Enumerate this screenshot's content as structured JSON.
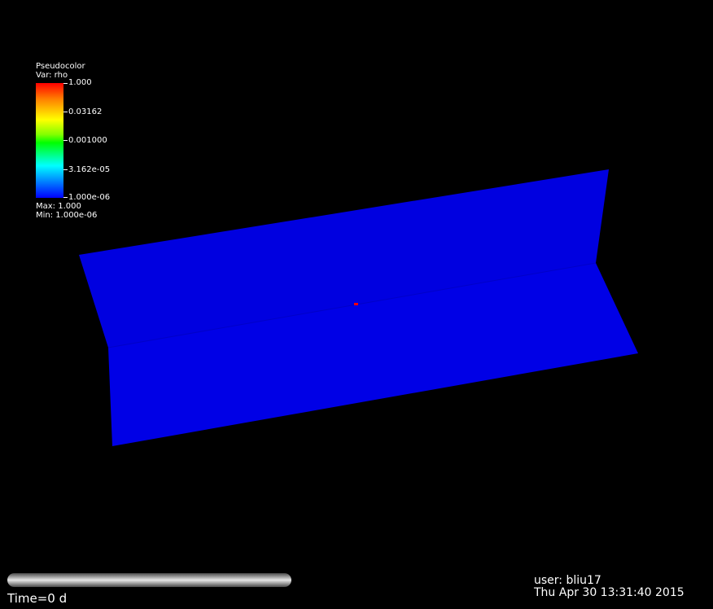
{
  "legend": {
    "title": "Pseudocolor",
    "var_label": "Var: rho",
    "ticks": [
      "1.000",
      "0.03162",
      "0.001000",
      "3.162e-05",
      "1.000e-06"
    ],
    "max_label": "Max:  1.000",
    "min_label": "Min:  1.000e-06",
    "scale": "log",
    "colors": [
      "#ff0000",
      "#ffff00",
      "#00ff00",
      "#00ffff",
      "#0000ff"
    ]
  },
  "surface": {
    "color": "#0000e6",
    "marker_color": "#ff0000"
  },
  "time": {
    "label": "Time=0 d"
  },
  "info": {
    "user": "user: bliu17",
    "datetime": "Thu Apr 30 13:31:40 2015"
  },
  "background": "#000000"
}
